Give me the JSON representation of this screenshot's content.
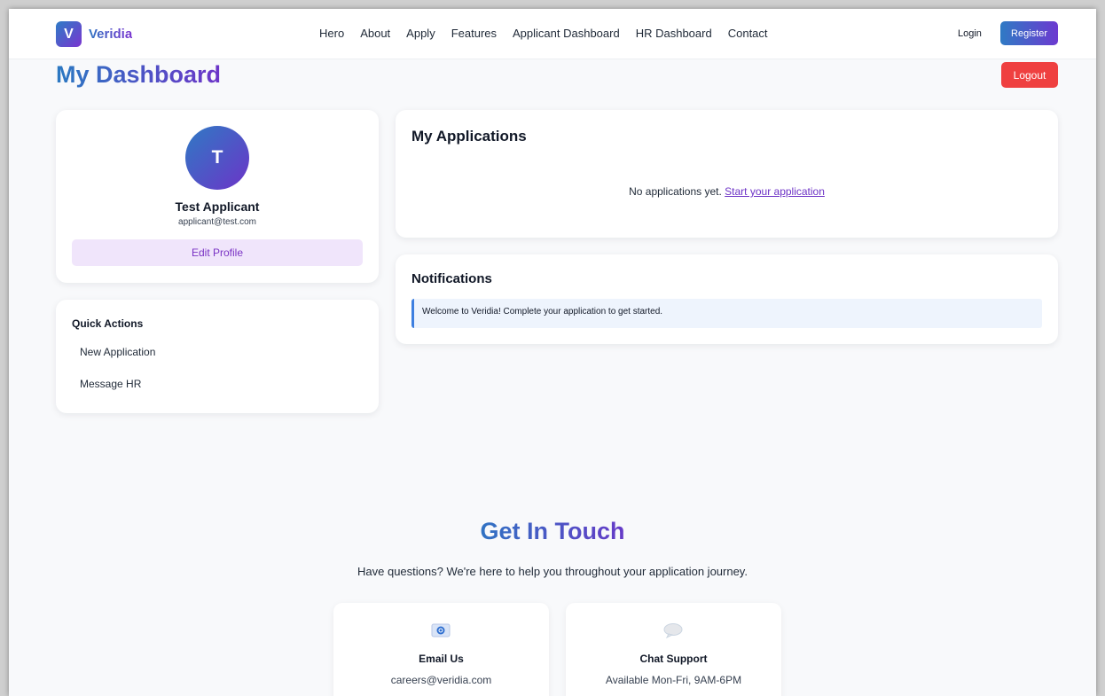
{
  "nav": {
    "logo_letter": "V",
    "brand": "Veridia",
    "items": [
      "Hero",
      "About",
      "Apply",
      "Features",
      "Applicant Dashboard",
      "HR Dashboard",
      "Contact"
    ],
    "login": "Login",
    "register": "Register"
  },
  "header": {
    "title": "My Dashboard",
    "logout": "Logout"
  },
  "profile": {
    "avatar_initial": "T",
    "name": "Test Applicant",
    "email": "applicant@test.com",
    "edit_button": "Edit Profile"
  },
  "quick_actions": {
    "title": "Quick Actions",
    "items": [
      "New Application",
      "Message HR"
    ]
  },
  "applications": {
    "title": "My Applications",
    "empty_text": "No applications yet.",
    "start_link": "Start your application"
  },
  "notifications": {
    "title": "Notifications",
    "items": [
      "Welcome to Veridia! Complete your application to get started."
    ]
  },
  "contact": {
    "title": "Get In Touch",
    "subtitle": "Have questions? We're here to help you throughout your application journey.",
    "cards": [
      {
        "icon": "email-icon",
        "title": "Email Us",
        "text": "careers@veridia.com"
      },
      {
        "icon": "chat-bubble-icon",
        "title": "Chat Support",
        "text": "Available Mon-Fri, 9AM-6PM"
      }
    ]
  },
  "colors": {
    "brand_blue": "#2f7ac4",
    "brand_purple": "#6c34c8",
    "logout_red": "#ef4040",
    "page_bg": "#f8f9fb"
  }
}
